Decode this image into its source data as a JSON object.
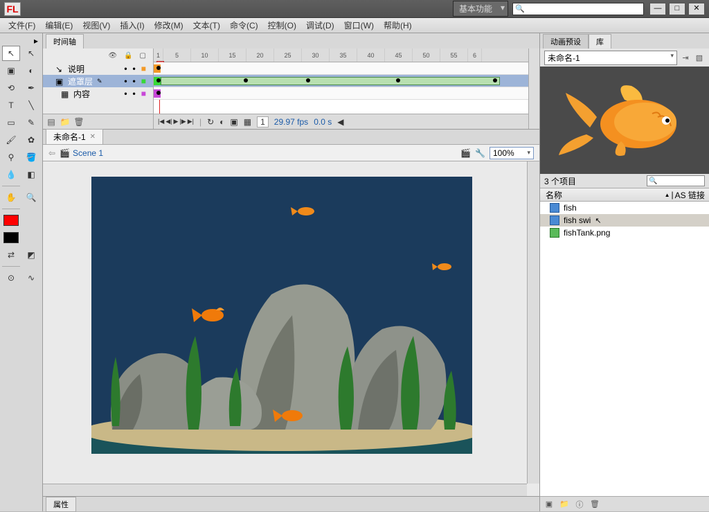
{
  "titlebar": {
    "logo": "FL",
    "workspace": "基本功能"
  },
  "menubar": {
    "items": [
      "文件(F)",
      "编辑(E)",
      "视图(V)",
      "插入(I)",
      "修改(M)",
      "文本(T)",
      "命令(C)",
      "控制(O)",
      "调试(D)",
      "窗口(W)",
      "帮助(H)"
    ]
  },
  "timeline": {
    "tab": "时间轴",
    "layers": [
      {
        "name": "说明",
        "icon": "pencil",
        "color": "#f39a28",
        "selected": false
      },
      {
        "name": "遮罩层",
        "icon": "mask",
        "color": "#37d837",
        "selected": true
      },
      {
        "name": "内容",
        "icon": "masked",
        "color": "#c848d8",
        "selected": false
      }
    ],
    "ruler_marks": [
      "1",
      "5",
      "10",
      "15",
      "20",
      "25",
      "30",
      "35",
      "40",
      "45",
      "50",
      "55",
      "6"
    ],
    "status": {
      "frame": "1",
      "fps": "29.97",
      "fps_unit": "fps",
      "time": "0.0",
      "time_unit": "s"
    }
  },
  "document": {
    "tab": "未命名-1",
    "scene": "Scene 1",
    "zoom": "100%"
  },
  "bottom": {
    "tab": "属性"
  },
  "right": {
    "tabs": [
      "动画预设",
      "库"
    ],
    "doc_dropdown": "未命名-1",
    "item_count": "3 个项目",
    "columns": {
      "name": "名称",
      "as": "AS 链接"
    },
    "items": [
      {
        "name": "fish",
        "type": "graphic",
        "selected": false
      },
      {
        "name": "fish swi",
        "type": "graphic",
        "selected": true
      },
      {
        "name": "fishTank.png",
        "type": "bitmap",
        "selected": false
      }
    ]
  }
}
